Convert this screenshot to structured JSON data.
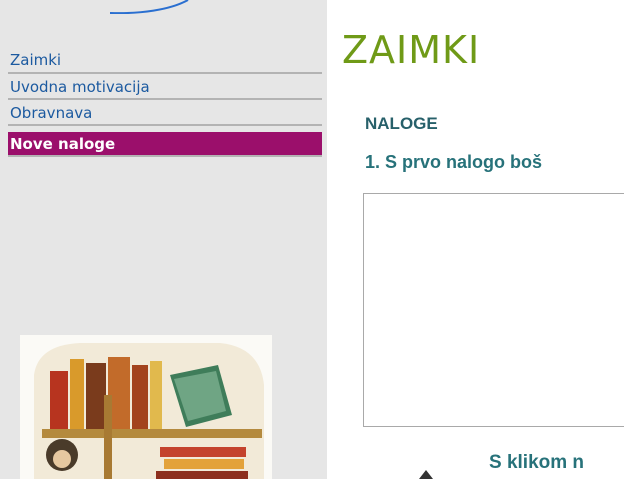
{
  "sidebar": {
    "items": [
      {
        "label": "Zaimki"
      },
      {
        "label": "Uvodna motivacija"
      },
      {
        "label": "Obravnava"
      },
      {
        "label": "Nove naloge"
      }
    ],
    "active_index": 3
  },
  "main": {
    "title": "ZAIMKI",
    "section": "NALOGE",
    "task": "1. S prvo nalogo boš",
    "click_hint": "S klikom n"
  },
  "colors": {
    "sidebar_bg": "#e6e6e6",
    "link": "#1c5aa0",
    "active_bg": "#9b0f6b",
    "title": "#6f9a17",
    "heading": "#27727a"
  },
  "icons": {
    "illustration": "books-illustration",
    "decoration": "blue-swoosh"
  }
}
